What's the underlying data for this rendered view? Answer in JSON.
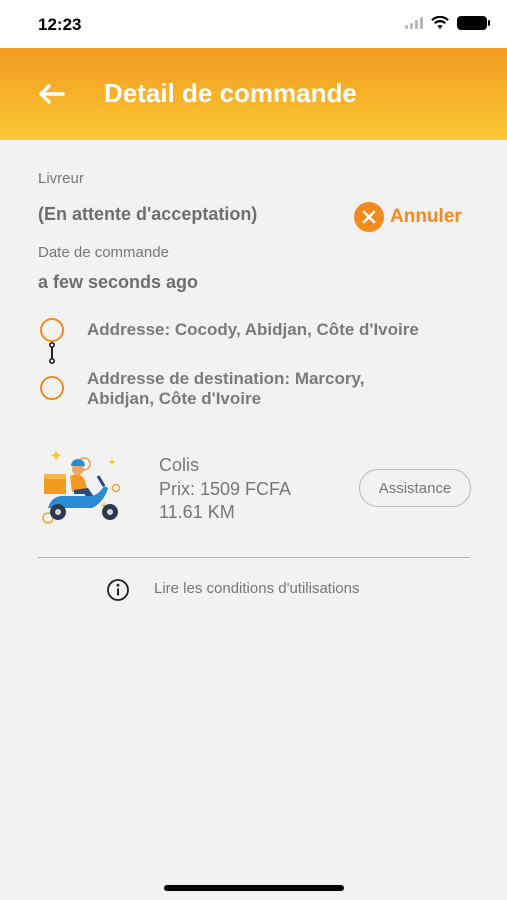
{
  "status_bar": {
    "time": "12:23"
  },
  "header": {
    "title": "Detail de commande"
  },
  "courier": {
    "label": "Livreur",
    "value": "(En attente d'acceptation)",
    "cancel_label": "Annuler"
  },
  "order_date": {
    "label": "Date de commande",
    "value": "a few seconds ago"
  },
  "addresses": {
    "pickup": "Addresse: Cocody, Abidjan, Côte d'Ivoire",
    "destination_line1": "Addresse de destination: Marcory,",
    "destination_line2": "Abidjan, Côte d'Ivoire"
  },
  "package": {
    "type": "Colis",
    "price": "Prix: 1509 FCFA",
    "distance": "11.61 KM",
    "assistance_label": "Assistance"
  },
  "terms": {
    "label": "Lire les conditions d'utilisations"
  },
  "colors": {
    "accent": "#f28a1d",
    "header_top": "#f29a22",
    "header_bottom": "#fbc734"
  },
  "icons": {
    "back": "arrow-left-icon",
    "cancel": "close-circle-icon",
    "info": "info-circle-icon",
    "delivery": "scooter-delivery-icon"
  }
}
